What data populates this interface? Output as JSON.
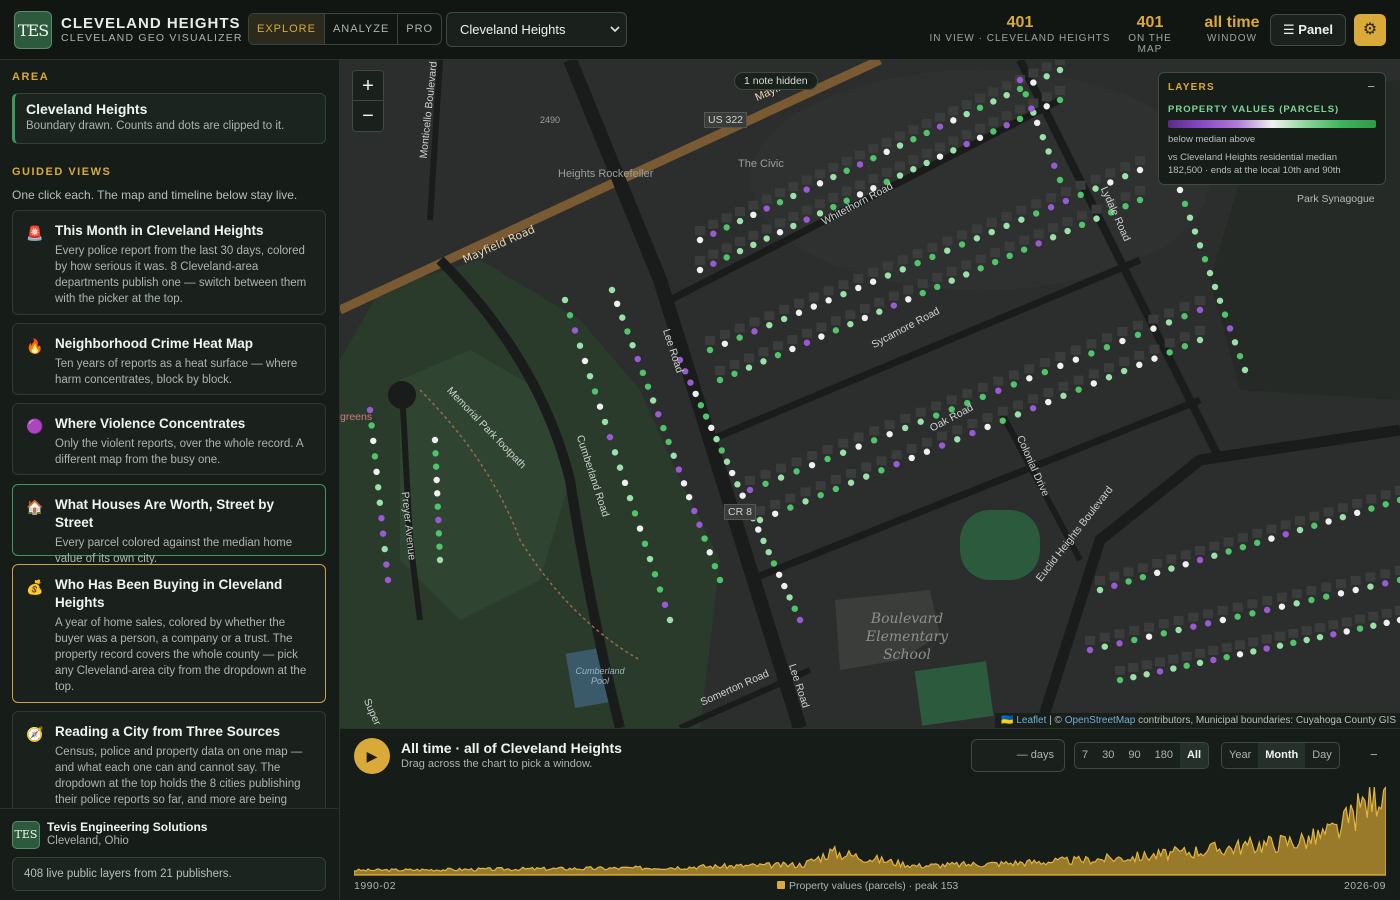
{
  "header": {
    "logo_text": "TES",
    "title": "CLEVELAND HEIGHTS",
    "subtitle": "CLEVELAND GEO VISUALIZER",
    "modes": [
      {
        "label": "EXPLORE",
        "active": true
      },
      {
        "label": "ANALYZE",
        "active": false
      },
      {
        "label": "PRO",
        "active": false
      }
    ],
    "city_select": {
      "value": "Cleveland Heights"
    },
    "stats": [
      {
        "value": "401",
        "label": "IN VIEW · CLEVELAND HEIGHTS"
      },
      {
        "value": "401",
        "label": "ON THE MAP"
      },
      {
        "value": "all time",
        "label": "WINDOW"
      }
    ],
    "panel_button": "☰ Panel",
    "settings_icon": "gear-icon"
  },
  "sidebar": {
    "area_heading": "AREA",
    "area": {
      "title": "Cleveland Heights",
      "desc": "Boundary drawn. Counts and dots are clipped to it."
    },
    "guided_heading": "GUIDED VIEWS",
    "guided_intro": "One click each. The map and timeline below stay live.",
    "guided_views": [
      {
        "icon": "🚨",
        "icon_name": "siren-icon",
        "title": "This Month in Cleveland Heights",
        "desc": "Every police report from the last 30 days, colored by how serious it was. 8 Cleveland-area departments publish one — switch between them with the picker at the top."
      },
      {
        "icon": "🔥",
        "icon_name": "flame-icon",
        "title": "Neighborhood Crime Heat Map",
        "desc": "Ten years of reports as a heat surface — where harm concentrates, block by block."
      },
      {
        "icon": "🟣",
        "icon_name": "purple-circle-icon",
        "title": "Where Violence Concentrates",
        "desc": "Only the violent reports, over the whole record. A different map from the busy one."
      },
      {
        "icon": "🏠",
        "icon_name": "house-icon",
        "title": "What Houses Are Worth, Street by Street",
        "desc": "Every parcel colored against the median home value of its own city."
      },
      {
        "icon": "💰",
        "icon_name": "money-bag-icon",
        "title": "Who Has Been Buying in Cleveland Heights",
        "desc": "A year of home sales, colored by whether the buyer was a person, a company or a trust. The property record covers the whole county — pick any Cleveland-area city from the dropdown at the top."
      },
      {
        "icon": "🧭",
        "icon_name": "compass-icon",
        "title": "Reading a City from Three Sources",
        "desc": "Census, police and property data on one map — and what each one can and cannot say. The dropdown at the top holds the 8 cities publishing their police reports so far, and more are being"
      }
    ],
    "footer": {
      "logo_text": "TES",
      "org": "Tevis Engineering Solutions",
      "location": "Cleveland, Ohio",
      "layers_note": "408 live public layers from 21 publishers."
    }
  },
  "map": {
    "zoom_in": "+",
    "zoom_out": "−",
    "hidden_note": "1 note hidden",
    "labels": {
      "mayfield_road": "Mayfield Road",
      "mayfield_road_2": "Mayfield",
      "us322": "US 322",
      "heights_rockefeller": "Heights Rockefeller",
      "the_civic": "The Civic",
      "whitethorn": "Whitethorn Road",
      "sycamore": "Sycamore Road",
      "oak": "Oak Road",
      "lydale": "Lydale Road",
      "lee_road": "Lee Road",
      "lee_road_2": "Lee Road",
      "cumberland": "Cumberland Road",
      "cr8": "CR 8",
      "colonial": "Colonial Drive",
      "euclid": "Euclid Heights Boulevard",
      "memorial": "Memorial Park footpath",
      "preyer": "Preyer Avenue",
      "monticello": "Monticello Boulevard",
      "somerton": "Somerton Road",
      "school": "Boulevard Elementary School",
      "pool": "Cumberland Pool",
      "park_synagogue": "Park Synagogue",
      "walgreens": "greens",
      "addr_2490": "2490",
      "super": "Super"
    },
    "layers_panel": {
      "heading": "LAYERS",
      "minimize": "−",
      "layer_title": "PROPERTY VALUES (PARCELS)",
      "scale_note": "below median above",
      "baseline": "vs Cleveland Heights residential median",
      "baseline_detail": "182,500 · ends at the local 10th and 90th"
    },
    "attribution": {
      "flag": "🇺🇦",
      "leaflet": "Leaflet",
      "osm": "OpenStreetMap",
      "rest": " contributors, Municipal boundaries: Cuyahoga County GIS"
    },
    "dot_colors": {
      "below": "#9a5ad4",
      "median": "#f0f0f0",
      "above": "#4fc46b",
      "above_light": "#9ae0a8"
    }
  },
  "timeline": {
    "title": "All time · all of Cleveland Heights",
    "subtitle": "Drag across the chart to pick a window.",
    "days_placeholder": "— days",
    "ranges": [
      {
        "label": "7",
        "active": false
      },
      {
        "label": "30",
        "active": false
      },
      {
        "label": "90",
        "active": false
      },
      {
        "label": "180",
        "active": false
      },
      {
        "label": "All",
        "active": true
      }
    ],
    "granularity": [
      {
        "label": "Year",
        "active": false
      },
      {
        "label": "Month",
        "active": true
      },
      {
        "label": "Day",
        "active": false
      }
    ],
    "minimize": "−",
    "start_label": "1990-02",
    "end_label": "2026-09",
    "legend": "Property values (parcels) · peak 153"
  },
  "chart_data": {
    "type": "area",
    "title": "",
    "series": [
      {
        "name": "Property values (parcels)",
        "color": "#d9aa3a"
      }
    ],
    "x_range": [
      "1990-02",
      "2026-09"
    ],
    "granularity": "month",
    "peak": 153,
    "trend_samples": [
      {
        "x": "1990",
        "y": 8
      },
      {
        "x": "1995",
        "y": 10
      },
      {
        "x": "2000",
        "y": 12
      },
      {
        "x": "2003",
        "y": 15
      },
      {
        "x": "2006",
        "y": 18
      },
      {
        "x": "2007",
        "y": 40
      },
      {
        "x": "2010",
        "y": 16
      },
      {
        "x": "2013",
        "y": 20
      },
      {
        "x": "2016",
        "y": 26
      },
      {
        "x": "2018",
        "y": 32
      },
      {
        "x": "2020",
        "y": 42
      },
      {
        "x": "2022",
        "y": 52
      },
      {
        "x": "2024",
        "y": 62
      },
      {
        "x": "2025",
        "y": 80
      },
      {
        "x": "2026-07",
        "y": 153
      }
    ]
  }
}
